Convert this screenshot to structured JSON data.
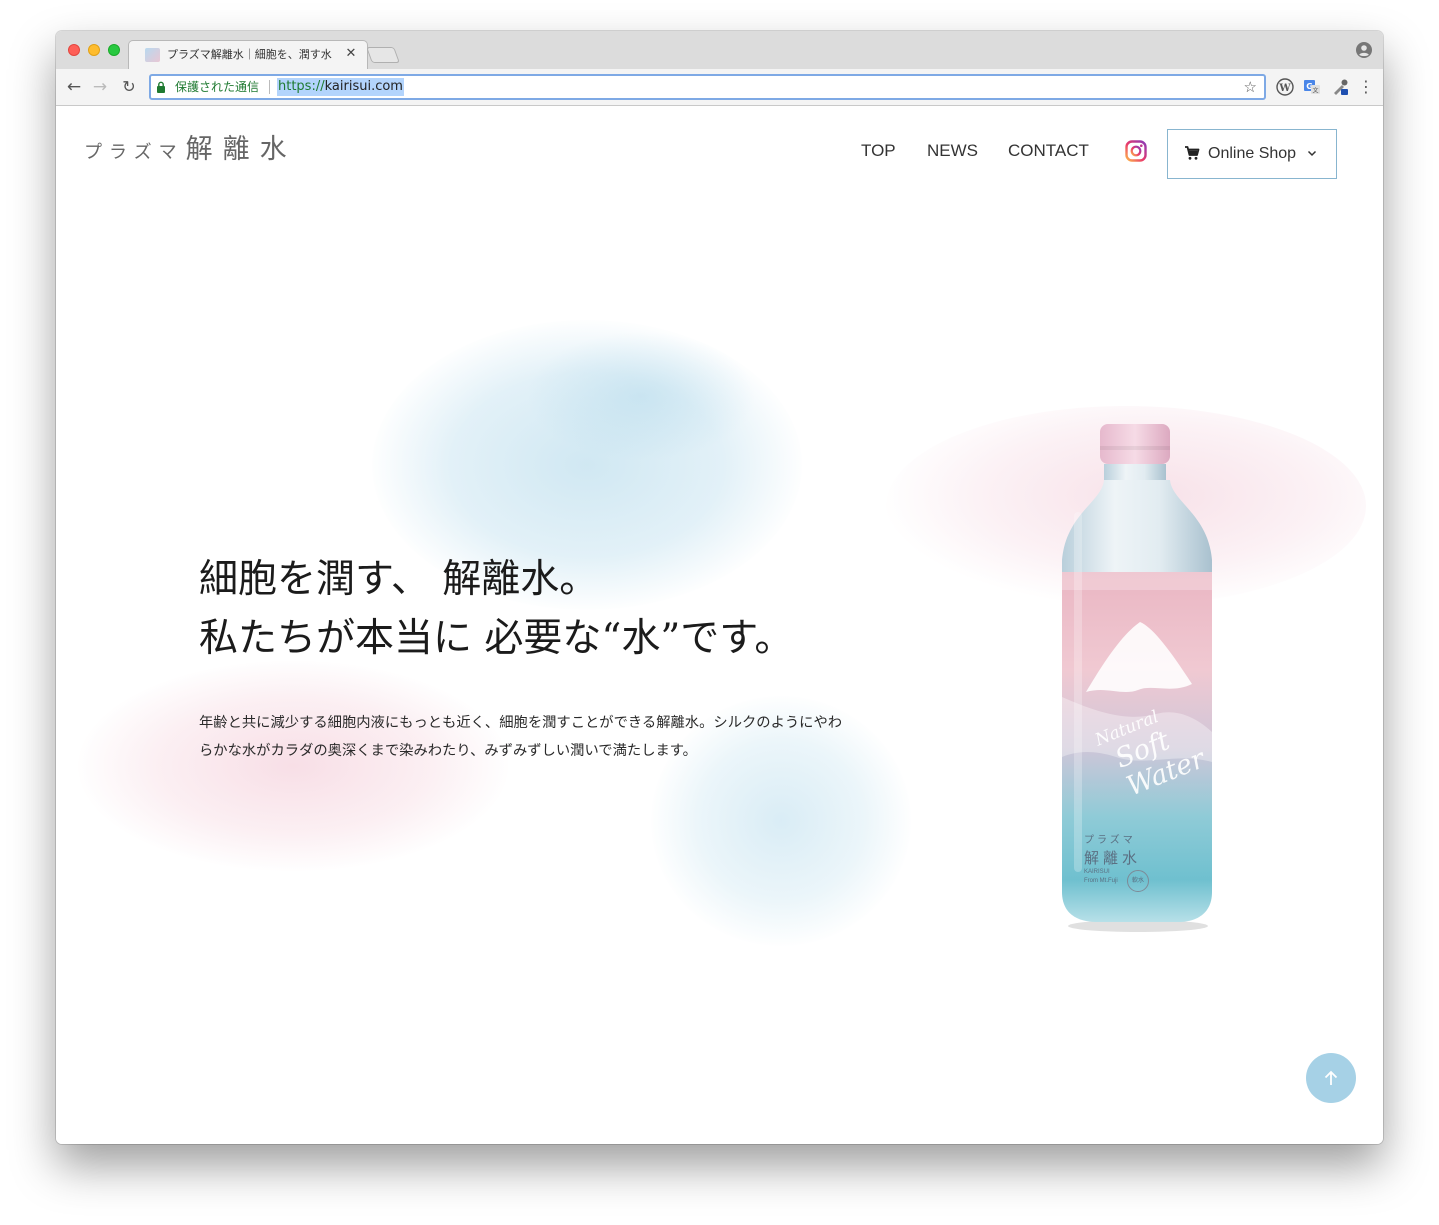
{
  "browser": {
    "tab_title": "プラズマ解離水｜細胞を、潤す水",
    "tab_close": "✕",
    "secure_label": "保護された通信",
    "url_scheme": "https://",
    "url_host": "kairisui.com",
    "omnibox_highlight": "#b3d4fc",
    "secure_color": "#1f7a31"
  },
  "site": {
    "logo_small": "プラズマ",
    "logo_big": "解離水",
    "nav": {
      "top": "TOP",
      "news": "NEWS",
      "contact": "CONTACT"
    },
    "shop_label": "Online Shop",
    "accent_border": "#88b5cf"
  },
  "hero": {
    "heading_line1": "細胞を潤す、 解離水。",
    "heading_line2": "私たちが本当に 必要な“水”です。",
    "body_line1": "年齢と共に減少する細胞内液にもっとも近く、細胞を潤すことができる解離水。シルクのようにやわ",
    "body_line2": "らかな水がカラダの奥深くまで染みわたり、みずみずしい潤いで満たします。"
  },
  "bottle": {
    "brand_kana": "プラズマ",
    "brand_kanji": "解離水",
    "brand_en": "KAIRISUI",
    "brand_origin": "From Mt.Fuji",
    "badge": "軟水",
    "script_line1": "Natural",
    "script_line2": "Soft Water"
  },
  "icons": {
    "instagram": "instagram-icon",
    "cart": "cart-icon",
    "scroll_top": "arrow-up-icon"
  },
  "colors": {
    "scroll_top_bg": "#a6d1e6",
    "wash_blue": "#aad5e8",
    "wash_pink": "#f2c4d2"
  }
}
